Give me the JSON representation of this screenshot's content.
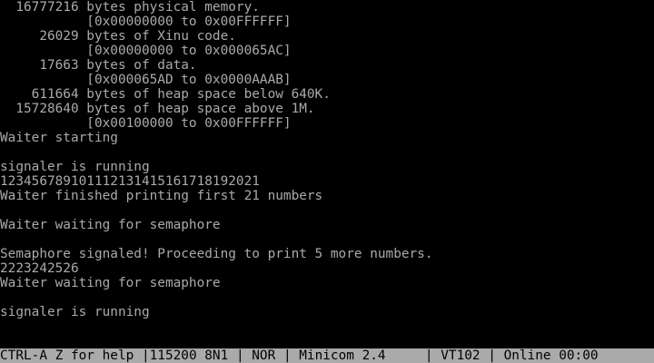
{
  "terminal": {
    "lines": [
      "  16777216 bytes physical memory.",
      "           [0x00000000 to 0x00FFFFFF]",
      "     26029 bytes of Xinu code.",
      "           [0x00000000 to 0x000065AC]",
      "     17663 bytes of data.",
      "           [0x000065AD to 0x0000AAAB]",
      "    611664 bytes of heap space below 640K.",
      "  15728640 bytes of heap space above 1M.",
      "           [0x00100000 to 0x00FFFFFF]",
      "Waiter starting",
      "",
      "signaler is running",
      "123456789101112131415161718192021",
      "Waiter finished printing first 21 numbers",
      "",
      "Waiter waiting for semaphore",
      "",
      "Semaphore signaled! Proceeding to print 5 more numbers.",
      "2223242526",
      "Waiter waiting for semaphore",
      "",
      "signaler is running"
    ]
  },
  "status_bar": {
    "help": "CTRL-A Z for help ",
    "serial": "115200 8N1 ",
    "mode": " NOR ",
    "program": " Minicom 2.4     ",
    "emulation": " VT102 ",
    "connection": " Online 00:00",
    "separator": "|"
  },
  "colors": {
    "background": "#000000",
    "text": "#aaaaaa",
    "status_bar_background": "#aaaaaa",
    "status_bar_text": "#000000"
  }
}
